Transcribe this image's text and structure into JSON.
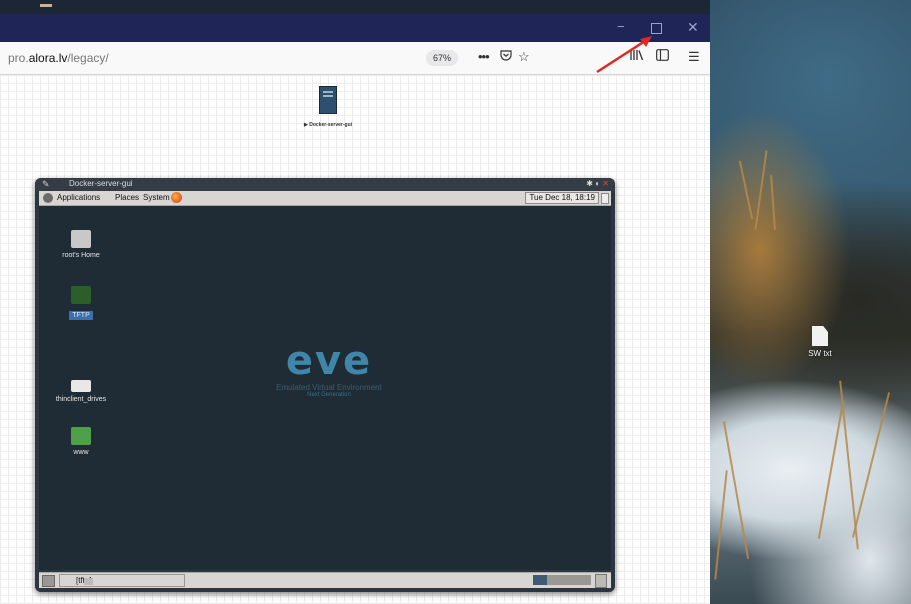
{
  "browser": {
    "url": {
      "prefix": "pro.",
      "host": "alora.lv",
      "path": "/legacy/"
    },
    "zoom": "67%",
    "window_controls": {
      "minimize": "−",
      "maximize": "",
      "close": "✕"
    },
    "toolbar_icons": [
      "more-actions-icon",
      "pocket-icon",
      "bookmark-star-icon",
      "library-icon",
      "sidebar-icon",
      "hamburger-menu-icon"
    ]
  },
  "canvas": {
    "node_label": "▶ Docker-server-gui"
  },
  "vnc_window": {
    "title": "Docker-server-gui",
    "panel": {
      "applications": "Applications",
      "places": "Places",
      "system": "System",
      "clock": "Tue Dec 18, 18:19"
    },
    "desktop_icons": [
      {
        "label": "root's Home"
      },
      {
        "label": "TFTP"
      },
      {
        "label": "thinclient_drives"
      },
      {
        "label": "www"
      }
    ],
    "logo": {
      "word": "eve",
      "subtitle": "Emulated Virtual Environment",
      "tagline": "Next Generation"
    },
    "taskbar": {
      "task_label": "[tftp]"
    }
  },
  "host_desktop": {
    "file_label": "SW txt"
  },
  "colors": {
    "browser_titlebar": "#1f2557",
    "vnc_desktop": "#202c35",
    "eve_blue": "#3f86a8",
    "annotation_arrow": "#e0281f"
  }
}
